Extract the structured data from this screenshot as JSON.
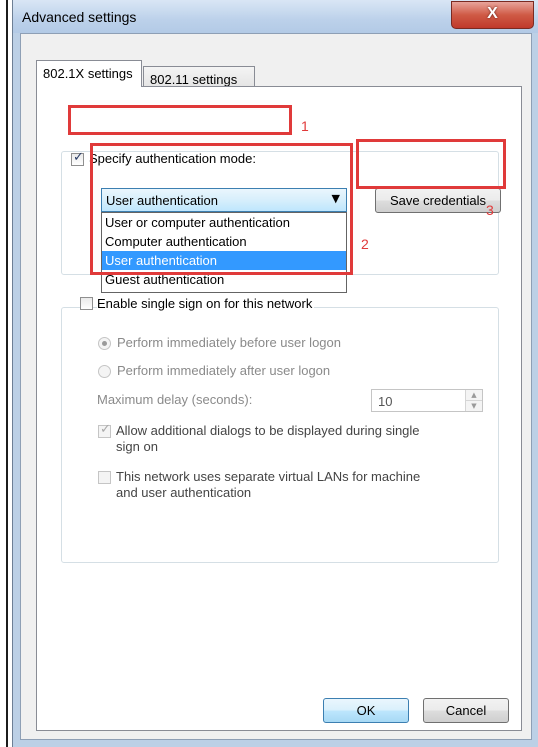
{
  "window": {
    "title": "Advanced settings",
    "close_label": "X"
  },
  "tabs": [
    {
      "label": "802.1X settings",
      "active": true
    },
    {
      "label": "802.11 settings",
      "active": false
    }
  ],
  "auth": {
    "specify_label": "Specify authentication mode:",
    "specify_checked": true,
    "selected_mode": "User authentication",
    "options": [
      "User or computer authentication",
      "Computer authentication",
      "User authentication",
      "Guest authentication"
    ],
    "save_credentials_label": "Save credentials"
  },
  "sso": {
    "enable_label": "Enable single sign on for this network",
    "enable_checked": false,
    "before_logon_label": "Perform immediately before user logon",
    "after_logon_label": "Perform immediately after user logon",
    "max_delay_label": "Maximum delay (seconds):",
    "max_delay_value": "10",
    "allow_dialogs_label_1": "Allow additional dialogs to be displayed during single",
    "allow_dialogs_label_2": "sign on",
    "allow_dialogs_checked": true,
    "vlan_label_1": "This network uses separate virtual LANs for machine",
    "vlan_label_2": "and user authentication",
    "vlan_checked": false
  },
  "buttons": {
    "ok": "OK",
    "cancel": "Cancel"
  },
  "annotations": {
    "n1": "1",
    "n2": "2",
    "n3": "3",
    "color": "#e03a3a"
  },
  "icons": {
    "close": "close-icon",
    "dropdown": "chevron-down-icon",
    "spin_up": "spin-up-icon",
    "spin_down": "spin-down-icon"
  }
}
